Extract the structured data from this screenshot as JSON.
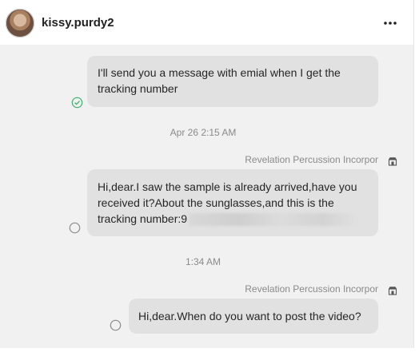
{
  "header": {
    "username": "kissy.purdy2"
  },
  "messages": [
    {
      "text": "I'll send you a message with emial when I get the tracking number"
    },
    {
      "timestamp": "Apr 26 2:15 AM"
    },
    {
      "sender": "Revelation Percussion Incorpor",
      "text_lines": [
        "Hi,dear.I saw the sample is already arrived,have you",
        "received it?About the sunglasses,and this is the",
        "tracking number:9"
      ]
    },
    {
      "timestamp": "1:34 AM"
    },
    {
      "sender": "Revelation Percussion Incorpor",
      "text": "Hi,dear.When do you want to post the video?"
    }
  ],
  "colors": {
    "chat_bg": "#f1f1f1",
    "bubble_bg": "#e1e1e1",
    "read_check": "#3fb06a"
  }
}
